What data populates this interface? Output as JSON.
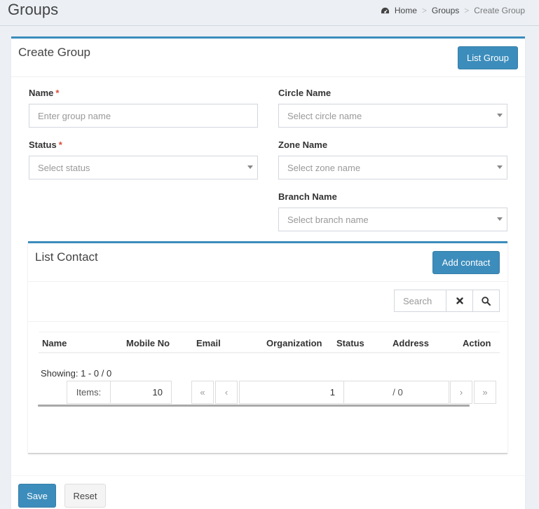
{
  "header": {
    "title": "Groups",
    "breadcrumb": [
      "Home",
      "Groups",
      "Create Group"
    ]
  },
  "box": {
    "title": "Create Group",
    "list_button": "List Group"
  },
  "form": {
    "name_label": "Name",
    "name_placeholder": "Enter group name",
    "circle_label": "Circle Name",
    "circle_placeholder": "Select circle name",
    "status_label": "Status",
    "status_placeholder": "Select status",
    "zone_label": "Zone Name",
    "zone_placeholder": "Select zone name",
    "branch_label": "Branch Name",
    "branch_placeholder": "Select branch name",
    "required_mark": "*"
  },
  "contacts": {
    "title": "List Contact",
    "add_button": "Add contact",
    "search_placeholder": "Search",
    "columns": [
      "Name",
      "Mobile No",
      "Email",
      "Organization",
      "Status",
      "Address",
      "Action"
    ],
    "showing": "Showing: 1 - 0 / 0",
    "items_label": "Items:",
    "items_value": "10",
    "first": "«",
    "prev": "‹",
    "page_value": "1",
    "page_total": "/ 0",
    "next": "›",
    "last": "»"
  },
  "footer": {
    "save": "Save",
    "reset": "Reset"
  },
  "colors": {
    "primary": "#3c8dbc",
    "required": "#dd4b39",
    "background": "#ecf0f5"
  }
}
